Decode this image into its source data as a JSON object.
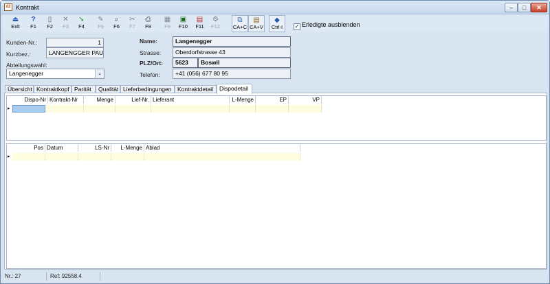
{
  "window": {
    "title": "Kontrakt",
    "app_icon_text": "d2"
  },
  "toolbar": {
    "buttons": [
      {
        "label": "Exit",
        "icon": "exit-icon",
        "glyph": "⏏",
        "disabled": false
      },
      {
        "label": "F1",
        "icon": "help-icon",
        "glyph": "?",
        "disabled": false
      },
      {
        "label": "F2",
        "icon": "new-document-icon",
        "glyph": "▯",
        "disabled": false
      },
      {
        "label": "F3",
        "icon": "delete-icon",
        "glyph": "✕",
        "disabled": true
      },
      {
        "label": "F4",
        "icon": "back-arrow-icon",
        "glyph": "➘",
        "disabled": false
      },
      {
        "label": "F5",
        "icon": "edit-icon",
        "glyph": "✎",
        "disabled": true
      },
      {
        "label": "F6",
        "icon": "search-icon",
        "glyph": "⌕",
        "disabled": false
      },
      {
        "label": "F7",
        "icon": "tools-icon",
        "glyph": "✂",
        "disabled": true
      },
      {
        "label": "F8",
        "icon": "print-icon",
        "glyph": "⎙",
        "disabled": false
      },
      {
        "label": "F9",
        "icon": "filter-icon",
        "glyph": "▦",
        "disabled": true
      },
      {
        "label": "F10",
        "icon": "save-icon",
        "glyph": "▣",
        "disabled": false
      },
      {
        "label": "F11",
        "icon": "calendar-icon",
        "glyph": "▤",
        "disabled": false
      },
      {
        "label": "F12",
        "icon": "settings-icon",
        "glyph": "⚙",
        "disabled": true
      },
      {
        "label": "CA+C",
        "icon": "copy-icon",
        "glyph": "⧉",
        "disabled": false
      },
      {
        "label": "CA+V",
        "icon": "paste-icon",
        "glyph": "▤",
        "disabled": false
      },
      {
        "label": "Ctrl-I",
        "icon": "info-icon",
        "glyph": "◆",
        "disabled": false
      }
    ],
    "hide_done_label": "Erledigte ausblenden",
    "hide_done_checked": true
  },
  "header": {
    "kunden_nr_label": "Kunden-Nr.:",
    "kunden_nr_value": "1",
    "kurzbez_label": "Kurzbez.:",
    "kurzbez_value": "LANGENGGER PAUL",
    "abteilung_label": "Abteilungswahl:",
    "abteilung_value": "Langenegger",
    "name_label": "Name:",
    "name_value": "Langenegger",
    "strasse_label": "Strasse:",
    "strasse_value": "Oberdorfstrasse 43",
    "plz_label": "PLZ/Ort:",
    "plz_value": "5623",
    "ort_value": "Boswil",
    "telefon_label": "Telefon:",
    "telefon_value": "+41 (056) 677 80 95"
  },
  "tabs": [
    {
      "label": "Übersicht"
    },
    {
      "label": "Kontraktkopf"
    },
    {
      "label": "Parität"
    },
    {
      "label": "Qualität"
    },
    {
      "label": "Lieferbedingungen"
    },
    {
      "label": "Kontraktdetail"
    },
    {
      "label": "Dispodetail"
    }
  ],
  "active_tab": "Dispodetail",
  "dispo_grid": {
    "columns": [
      "Dispo-Nr",
      "Kontrakt-Nr",
      "Menge",
      "Lief-Nr.",
      "Lieferant",
      "L-Menge",
      "EP",
      "VP"
    ],
    "row_marker": "▸"
  },
  "position_grid": {
    "columns": [
      "Pos",
      "Datum",
      "LS-Nr",
      "L-Menge",
      "Ablad"
    ],
    "row_marker": "▸"
  },
  "status": {
    "nr": "Nr.: 27",
    "ref": "Ref: 92558.4"
  },
  "colors": {
    "window_bg": "#d9e4f1",
    "grid_row": "#fffde0",
    "selected_cell": "#a9cdee"
  }
}
